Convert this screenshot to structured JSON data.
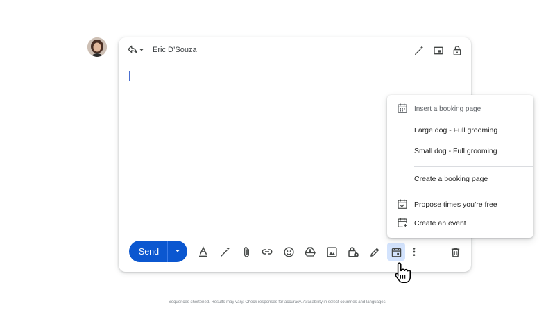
{
  "compose": {
    "recipient": "Eric D’Souza",
    "header_icons": [
      "magic-pen-icon",
      "popout-icon",
      "lock-icon"
    ]
  },
  "toolbar": {
    "send_label": "Send",
    "icons": [
      "formatting-icon",
      "magic-pen-icon",
      "attach-icon",
      "link-icon",
      "emoji-icon",
      "drive-icon",
      "photo-icon",
      "confidential-icon",
      "signature-icon",
      "calendar-icon",
      "more-icon",
      "trash-icon"
    ],
    "active_icon": "calendar-icon"
  },
  "menu": {
    "header": "Insert a booking page",
    "items": [
      "Large dog - Full grooming",
      "Small dog - Full grooming",
      "Create a booking page",
      "Propose times you’re free",
      "Create an event"
    ]
  },
  "footnote": "Sequences shortened. Results may vary. Check responses for accuracy. Availability in select countries and languages.",
  "colors": {
    "accent": "#0b57d0",
    "active_icon_bg": "#d3e3fd",
    "icon": "#444746",
    "divider": "#dadce0"
  }
}
